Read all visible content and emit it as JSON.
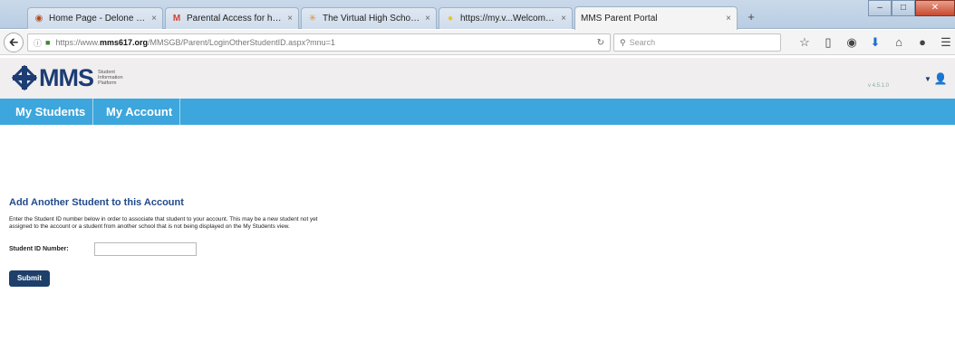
{
  "browser": {
    "tabs": [
      {
        "title": "Home Page - Delone Cath...",
        "icon": "globe-icon",
        "close": "×"
      },
      {
        "title": "Parental Access for https://...",
        "icon": "gmail-icon",
        "close": "×"
      },
      {
        "title": "The Virtual High School O...",
        "icon": "vhs-icon",
        "close": "×"
      },
      {
        "title": "https://my.v...Welcome.aspx",
        "icon": "bulb-icon",
        "close": "×"
      },
      {
        "title": "MMS Parent Portal",
        "icon": "none",
        "close": "×"
      }
    ],
    "new_tab": "+",
    "url_prefix": "https://www.",
    "url_host": "mms617.org",
    "url_path": "/MMSGB/Parent/LoginOtherStudentID.aspx?mnu=1",
    "search_placeholder": "Search"
  },
  "app": {
    "logo_text": "MMS",
    "logo_tagline": [
      "Student",
      "Information",
      "Platform"
    ],
    "version": "v 4.5.1.0",
    "menu": [
      "My Students",
      "My Account"
    ]
  },
  "page": {
    "title": "Add Another Student to this Account",
    "description_line1": "Enter the Student ID number below in order to associate that student to your account. This may be a new student not yet",
    "description_line2": "assigned to the account or a student from another school that is not being displayed on the My Students view.",
    "field_label": "Student ID Number:",
    "field_value": "",
    "submit_label": "Submit"
  },
  "colors": {
    "brand_navy": "#1c3c74",
    "menu_blue": "#3da6dc",
    "title_blue": "#214b8c",
    "button_navy": "#1e3f6a"
  }
}
